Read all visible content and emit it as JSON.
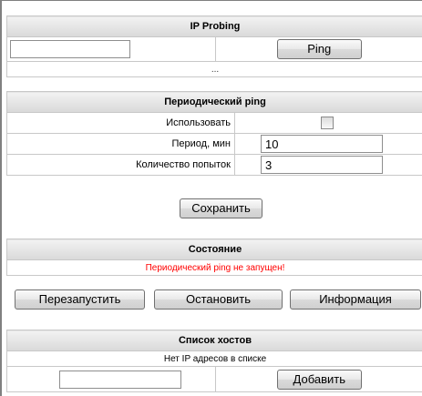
{
  "ip_probing": {
    "title": "IP Probing",
    "ip_value": "",
    "ping_label": "Ping",
    "result": "..."
  },
  "periodic_ping": {
    "title": "Периодический ping",
    "use_label": "Использовать",
    "use_checked": false,
    "period_label": "Период, мин",
    "period_value": "10",
    "attempts_label": "Количество попыток",
    "attempts_value": "3",
    "save_label": "Сохранить"
  },
  "status": {
    "title": "Состояние",
    "message": "Периодический ping не запущен!",
    "message_color": "#ff0000",
    "restart_label": "Перезапустить",
    "stop_label": "Остановить",
    "info_label": "Информация"
  },
  "hosts": {
    "title": "Список хостов",
    "empty_text": "Нет IP адресов в списке",
    "ip_value": "",
    "add_label": "Добавить"
  }
}
